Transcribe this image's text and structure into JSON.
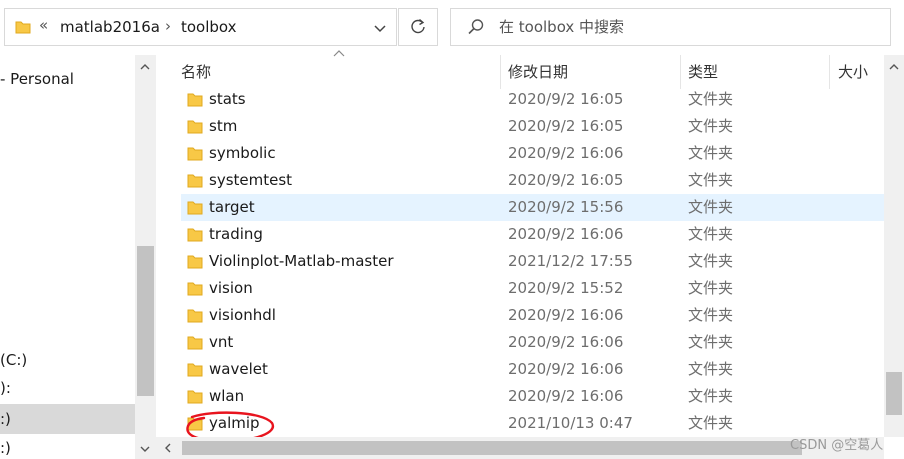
{
  "address": {
    "separator": "«",
    "crumbs": [
      "matlab2016a",
      "toolbox"
    ],
    "crumb_separator": "›"
  },
  "search": {
    "placeholder": "在 toolbox 中搜索"
  },
  "nav": {
    "items": [
      {
        "label": "- Personal"
      },
      {
        "label": "(C:)"
      },
      {
        "label": "):"
      },
      {
        "label": ":)"
      },
      {
        "label": ":)"
      }
    ]
  },
  "columns": {
    "name": "名称",
    "date": "修改日期",
    "type": "类型",
    "size": "大小"
  },
  "files": [
    {
      "name": "stats",
      "date": "2020/9/2 16:05",
      "type": "文件夹"
    },
    {
      "name": "stm",
      "date": "2020/9/2 16:05",
      "type": "文件夹"
    },
    {
      "name": "symbolic",
      "date": "2020/9/2 16:06",
      "type": "文件夹"
    },
    {
      "name": "systemtest",
      "date": "2020/9/2 16:05",
      "type": "文件夹"
    },
    {
      "name": "target",
      "date": "2020/9/2 15:56",
      "type": "文件夹",
      "selected": true
    },
    {
      "name": "trading",
      "date": "2020/9/2 16:06",
      "type": "文件夹"
    },
    {
      "name": "Violinplot-Matlab-master",
      "date": "2021/12/2 17:55",
      "type": "文件夹"
    },
    {
      "name": "vision",
      "date": "2020/9/2 15:52",
      "type": "文件夹"
    },
    {
      "name": "visionhdl",
      "date": "2020/9/2 16:06",
      "type": "文件夹"
    },
    {
      "name": "vnt",
      "date": "2020/9/2 16:06",
      "type": "文件夹"
    },
    {
      "name": "wavelet",
      "date": "2020/9/2 16:06",
      "type": "文件夹"
    },
    {
      "name": "wlan",
      "date": "2020/9/2 16:06",
      "type": "文件夹"
    },
    {
      "name": "yalmip",
      "date": "2021/10/13 0:47",
      "type": "文件夹",
      "annotated": true
    }
  ],
  "watermark": "CSDN @空葛人",
  "colors": {
    "folder": "#f8c846",
    "folder_dark": "#e0a91f",
    "selection": "#e5f3ff",
    "annotation": "#e8141e"
  },
  "icons": {
    "folder": "folder-icon",
    "search": "search-icon",
    "refresh": "refresh-icon"
  }
}
